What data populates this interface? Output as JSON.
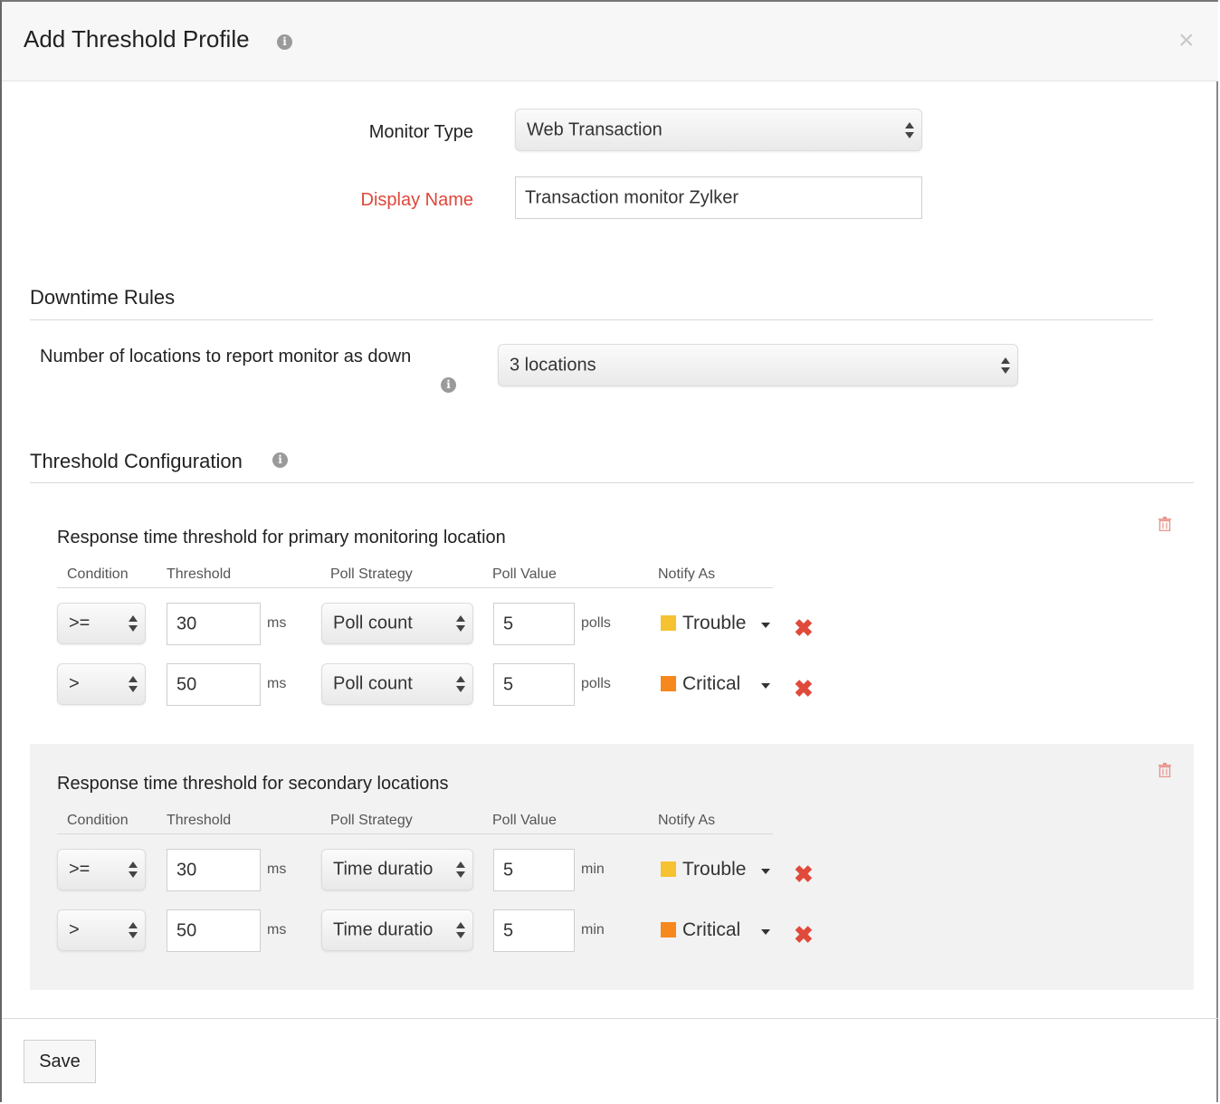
{
  "header": {
    "title": "Add Threshold Profile",
    "info_icon": "info-icon",
    "close_label": "×"
  },
  "form": {
    "monitor_type_label": "Monitor Type",
    "monitor_type_value": "Web Transaction",
    "display_name_label": "Display Name",
    "display_name_value": "Transaction monitor Zylker",
    "display_name_label_color": "#e0463a"
  },
  "downtime": {
    "title": "Downtime Rules",
    "locations_label": "Number of locations to report monitor as down",
    "locations_value": "3 locations"
  },
  "threshold": {
    "title": "Threshold Configuration",
    "columns": [
      "Condition",
      "Threshold",
      "Poll Strategy",
      "Poll Value",
      "Notify As"
    ],
    "primary": {
      "title": "Response time threshold for primary monitoring location",
      "rows": [
        {
          "condition": ">=",
          "threshold": "30",
          "threshold_unit": "ms",
          "strategy": "Poll count",
          "poll_value": "5",
          "poll_unit": "polls",
          "notify": "Trouble",
          "notify_color": "#f6c231"
        },
        {
          "condition": ">",
          "threshold": "50",
          "threshold_unit": "ms",
          "strategy": "Poll count",
          "poll_value": "5",
          "poll_unit": "polls",
          "notify": "Critical",
          "notify_color": "#f7881e"
        }
      ]
    },
    "secondary": {
      "title": "Response time threshold for secondary locations",
      "rows": [
        {
          "condition": ">=",
          "threshold": "30",
          "threshold_unit": "ms",
          "strategy": "Time duratio",
          "poll_value": "5",
          "poll_unit": "min",
          "notify": "Trouble",
          "notify_color": "#f6c231"
        },
        {
          "condition": ">",
          "threshold": "50",
          "threshold_unit": "ms",
          "strategy": "Time duratio",
          "poll_value": "5",
          "poll_unit": "min",
          "notify": "Critical",
          "notify_color": "#f7881e"
        }
      ]
    }
  },
  "footer": {
    "save_label": "Save"
  },
  "colors": {
    "delete_x": "#e04a3b",
    "trash": "#e8948c",
    "panel_bg": "#f2f2f2"
  }
}
